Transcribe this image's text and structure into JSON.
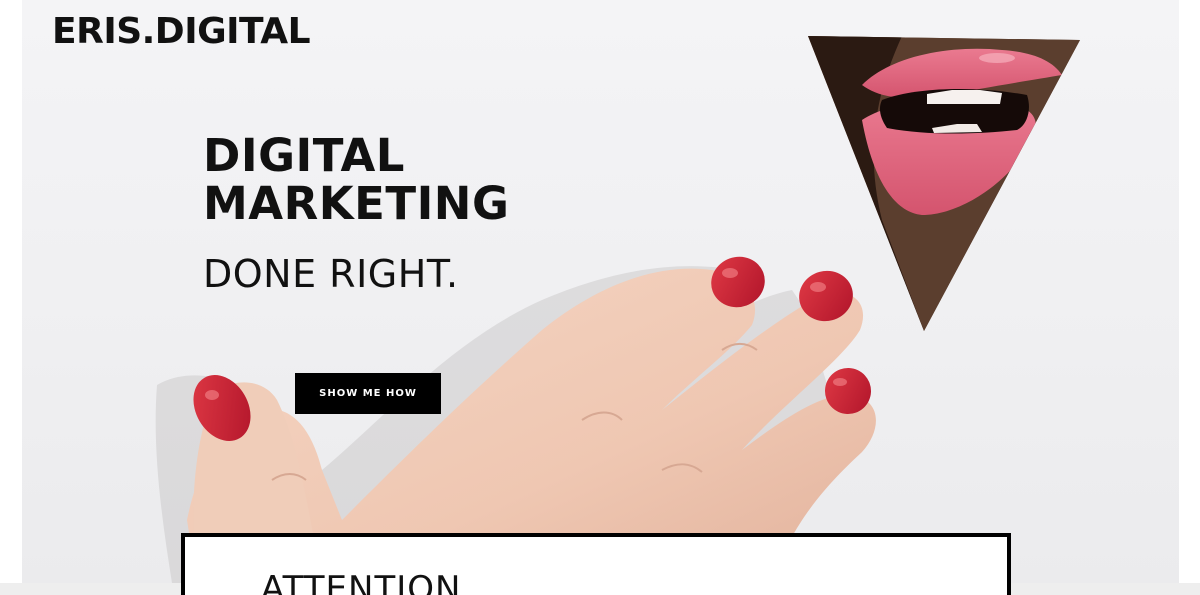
{
  "brand": {
    "logo_text": "ERIS.DIGITAL"
  },
  "hero": {
    "headline_line1": "DIGITAL",
    "headline_line2": "MARKETING",
    "subheadline": "DONE RIGHT.",
    "cta_label": "SHOW ME HOW",
    "image_description_icons": [
      "hand-with-red-nails-image",
      "triangle-lips-image"
    ]
  },
  "next_section": {
    "title": "ATTENTION"
  },
  "colors": {
    "text": "#111111",
    "button_bg": "#000000",
    "button_text": "#ffffff",
    "background": "#f1f1f3",
    "nail_red": "#c8202f",
    "lip_pink": "#e0607a",
    "skin": "#f1cbb6"
  }
}
